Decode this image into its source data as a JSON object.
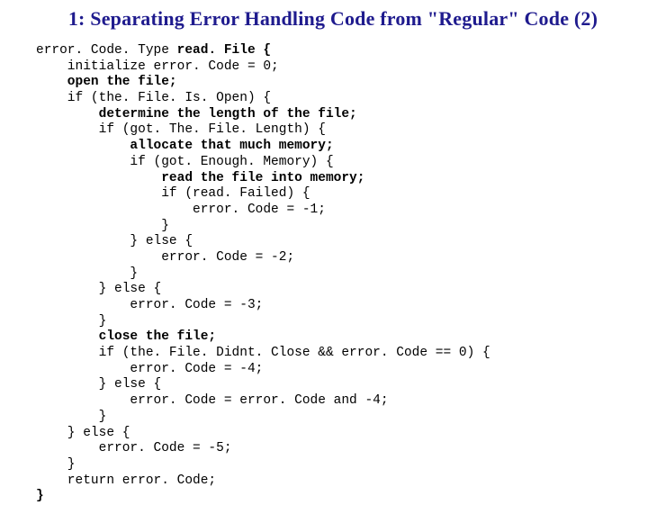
{
  "title": "1: Separating Error Handling Code from \"Regular\" Code (2)",
  "code": {
    "l1a": "error. Code. Type ",
    "l1b": "read. File {",
    "l2": "    initialize error. Code = 0;",
    "l3": "    open the file;",
    "l4": "    if (the. File. Is. Open) {",
    "l5": "        determine the length of the file;",
    "l6": "        if (got. The. File. Length) {",
    "l7": "            allocate that much memory;",
    "l8": "            if (got. Enough. Memory) {",
    "l9": "                read the file into memory;",
    "l10": "                if (read. Failed) {",
    "l11": "                    error. Code = -1;",
    "l12": "                }",
    "l13": "            } else {",
    "l14": "                error. Code = -2;",
    "l15": "            }",
    "l16": "        } else {",
    "l17": "            error. Code = -3;",
    "l18": "        }",
    "l19": "        close the file;",
    "l20": "        if (the. File. Didnt. Close && error. Code == 0) {",
    "l21": "            error. Code = -4;",
    "l22": "        } else {",
    "l23": "            error. Code = error. Code and -4;",
    "l24": "        }",
    "l25": "    } else {",
    "l26": "        error. Code = -5;",
    "l27": "    }",
    "l28": "    return error. Code;",
    "l29": "}"
  }
}
